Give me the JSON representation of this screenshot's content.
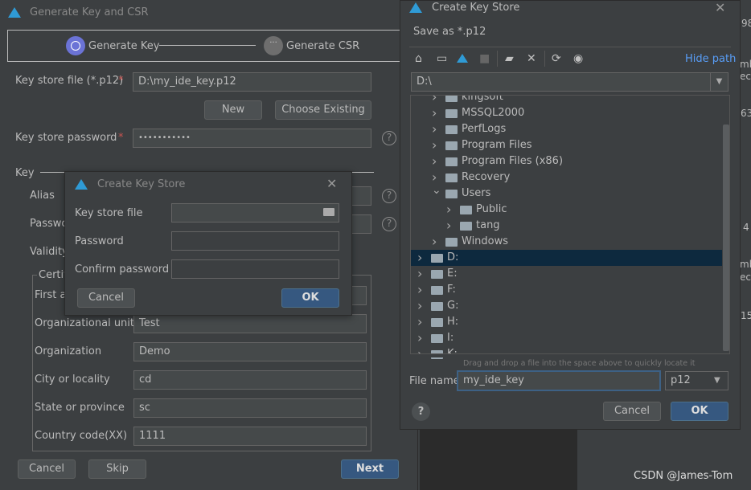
{
  "main_dialog": {
    "title": "Generate Key and CSR",
    "steps": [
      {
        "label": "Generate Key",
        "state": "active"
      },
      {
        "label": "Generate CSR",
        "state": "pending"
      }
    ],
    "keystore_file_label": "Key store file (*.p12)",
    "keystore_file_value": "D:\\my_ide_key.p12",
    "new_label": "New",
    "choose_existing_label": "Choose Existing",
    "keystore_password_label": "Key store password",
    "keystore_password_value": "•••••••••••",
    "required_mark": "*",
    "key_section_label": "Key",
    "alias_label": "Alias",
    "password_label": "Passwo",
    "validity_label": "Validity(",
    "certificate_label": "Certifi",
    "first_last_label": "First ar",
    "org_unit_label": "Organizational unit",
    "org_unit_value": "Test",
    "org_label": "Organization",
    "org_value": "Demo",
    "city_label": "City or locality",
    "city_value": "cd",
    "state_label": "State or province",
    "state_value": "sc",
    "country_label": "Country code(XX)",
    "country_value": "1111",
    "cancel_label": "Cancel",
    "skip_label": "Skip",
    "next_label": "Next"
  },
  "small_dialog": {
    "title": "Create Key Store",
    "keystore_file_label": "Key store file",
    "password_label": "Password",
    "confirm_password_label": "Confirm password",
    "cancel_label": "Cancel",
    "ok_label": "OK"
  },
  "file_dialog": {
    "title": "Create Key Store",
    "subtitle": "Save as *.p12",
    "toolbar_icons": [
      "home-icon",
      "desktop-icon",
      "project-icon",
      "module-icon",
      "new-folder-icon",
      "delete-icon",
      "refresh-icon",
      "show-hidden-icon"
    ],
    "hide_path_label": "Hide path",
    "path_value": "D:\\",
    "tree": [
      {
        "name": "kingsoft",
        "level": 1,
        "expanded": false
      },
      {
        "name": "MSSQL2000",
        "level": 1,
        "expanded": false
      },
      {
        "name": "PerfLogs",
        "level": 1,
        "expanded": false
      },
      {
        "name": "Program Files",
        "level": 1,
        "expanded": false
      },
      {
        "name": "Program Files (x86)",
        "level": 1,
        "expanded": false
      },
      {
        "name": "Recovery",
        "level": 1,
        "expanded": false
      },
      {
        "name": "Users",
        "level": 1,
        "expanded": true
      },
      {
        "name": "Public",
        "level": 2,
        "expanded": false
      },
      {
        "name": "tang",
        "level": 2,
        "expanded": false
      },
      {
        "name": "Windows",
        "level": 1,
        "expanded": false
      },
      {
        "name": "D:",
        "level": 0,
        "expanded": false,
        "selected": true
      },
      {
        "name": "E:",
        "level": 0,
        "expanded": false
      },
      {
        "name": "F:",
        "level": 0,
        "expanded": false
      },
      {
        "name": "G:",
        "level": 0,
        "expanded": false
      },
      {
        "name": "H:",
        "level": 0,
        "expanded": false
      },
      {
        "name": "I:",
        "level": 0,
        "expanded": false
      },
      {
        "name": "K:",
        "level": 0,
        "expanded": false
      }
    ],
    "drag_hint": "Drag and drop a file into the space above to quickly locate it",
    "file_name_label": "File name:",
    "file_name_value": "my_ide_key",
    "file_type_value": "p12",
    "cancel_label": "Cancel",
    "ok_label": "OK"
  },
  "background_fragments": [
    "98",
    "mb",
    "eco",
    "63",
    "4",
    "mb",
    "eco",
    "15"
  ],
  "watermark": "CSDN @James-Tom",
  "colors": {
    "accent": "#365880",
    "link": "#589df6",
    "step_active": "#6b73d6",
    "selected_row": "#0d293e"
  }
}
